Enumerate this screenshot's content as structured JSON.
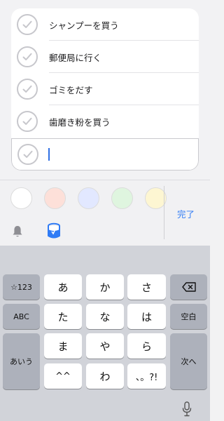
{
  "list": {
    "items": [
      {
        "label": "シャンプーを買う"
      },
      {
        "label": "郵便局に行く"
      },
      {
        "label": "ゴミをだす"
      },
      {
        "label": "歯磨き粉を買う"
      }
    ],
    "new_item_value": ""
  },
  "toolbar": {
    "swatch_colors": [
      "#ffffff",
      "#fde0d9",
      "#e2e8ff",
      "#dff5df",
      "#fdf6d2"
    ],
    "done_label": "完了",
    "accent_color": "#2f7bf5",
    "icons": [
      "bell-icon",
      "paint-bucket-icon"
    ]
  },
  "keyboard": {
    "keys": {
      "num_toggle": "☆123",
      "a": "あ",
      "ka": "か",
      "sa": "さ",
      "abc": "ABC",
      "ta": "た",
      "na": "な",
      "ha": "は",
      "space": "空白",
      "aiu": "あいう",
      "ma": "ま",
      "ya": "や",
      "ra": "ら",
      "next": "次へ",
      "dakuten": "^^",
      "wa": "わ",
      "punct": "、。?!"
    },
    "icons": [
      "delete-icon",
      "mic-icon"
    ]
  }
}
